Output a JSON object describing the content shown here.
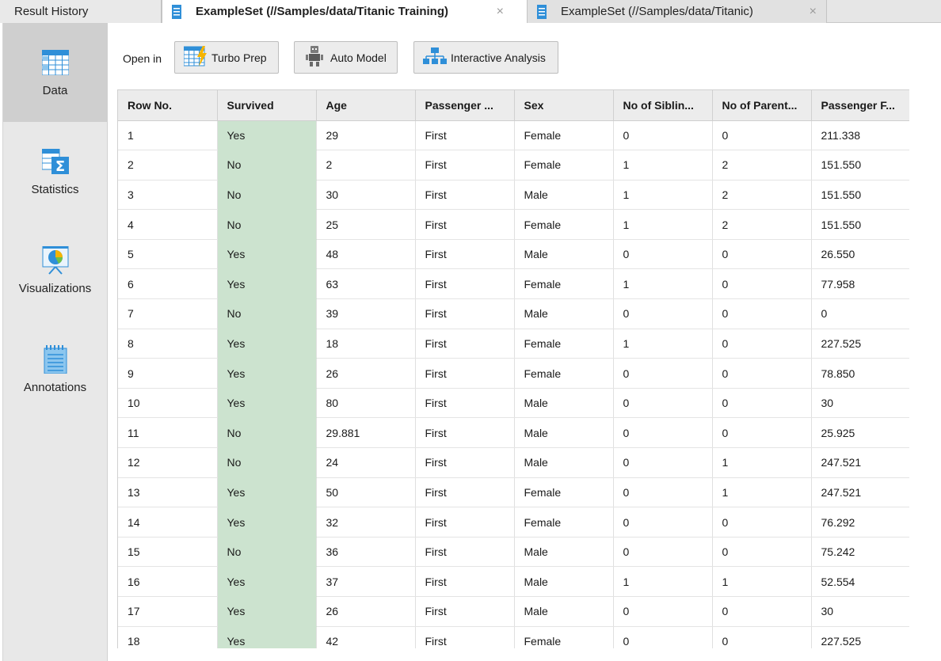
{
  "tabs": [
    {
      "label": "Result History"
    },
    {
      "label": "ExampleSet (//Samples/data/Titanic Training)",
      "close": "×"
    },
    {
      "label": "ExampleSet (//Samples/data/Titanic)",
      "close": "×"
    }
  ],
  "sidebar": {
    "items": [
      {
        "label": "Data"
      },
      {
        "label": "Statistics"
      },
      {
        "label": "Visualizations"
      },
      {
        "label": "Annotations"
      }
    ]
  },
  "toolbar": {
    "open_in_label": "Open in",
    "turbo_prep_label": "Turbo Prep",
    "auto_model_label": "Auto Model",
    "interactive_analysis_label": "Interactive Analysis"
  },
  "table": {
    "columns": [
      "Row No.",
      "Survived",
      "Age",
      "Passenger ...",
      "Sex",
      "No of Siblin...",
      "No of Parent...",
      "Passenger F..."
    ],
    "rows": [
      [
        "1",
        "Yes",
        "29",
        "First",
        "Female",
        "0",
        "0",
        "211.338"
      ],
      [
        "2",
        "No",
        "2",
        "First",
        "Female",
        "1",
        "2",
        "151.550"
      ],
      [
        "3",
        "No",
        "30",
        "First",
        "Male",
        "1",
        "2",
        "151.550"
      ],
      [
        "4",
        "No",
        "25",
        "First",
        "Female",
        "1",
        "2",
        "151.550"
      ],
      [
        "5",
        "Yes",
        "48",
        "First",
        "Male",
        "0",
        "0",
        "26.550"
      ],
      [
        "6",
        "Yes",
        "63",
        "First",
        "Female",
        "1",
        "0",
        "77.958"
      ],
      [
        "7",
        "No",
        "39",
        "First",
        "Male",
        "0",
        "0",
        "0"
      ],
      [
        "8",
        "Yes",
        "18",
        "First",
        "Female",
        "1",
        "0",
        "227.525"
      ],
      [
        "9",
        "Yes",
        "26",
        "First",
        "Female",
        "0",
        "0",
        "78.850"
      ],
      [
        "10",
        "Yes",
        "80",
        "First",
        "Male",
        "0",
        "0",
        "30"
      ],
      [
        "11",
        "No",
        "29.881",
        "First",
        "Male",
        "0",
        "0",
        "25.925"
      ],
      [
        "12",
        "No",
        "24",
        "First",
        "Male",
        "0",
        "1",
        "247.521"
      ],
      [
        "13",
        "Yes",
        "50",
        "First",
        "Female",
        "0",
        "1",
        "247.521"
      ],
      [
        "14",
        "Yes",
        "32",
        "First",
        "Female",
        "0",
        "0",
        "76.292"
      ],
      [
        "15",
        "No",
        "36",
        "First",
        "Male",
        "0",
        "0",
        "75.242"
      ],
      [
        "16",
        "Yes",
        "37",
        "First",
        "Male",
        "1",
        "1",
        "52.554"
      ],
      [
        "17",
        "Yes",
        "26",
        "First",
        "Male",
        "0",
        "0",
        "30"
      ],
      [
        "18",
        "Yes",
        "42",
        "First",
        "Female",
        "0",
        "0",
        "227.525"
      ]
    ]
  },
  "colors": {
    "survived_cell": "#cce3cf",
    "sidebar_active": "#cfcfcf",
    "icon_blue": "#2f8fd8"
  }
}
